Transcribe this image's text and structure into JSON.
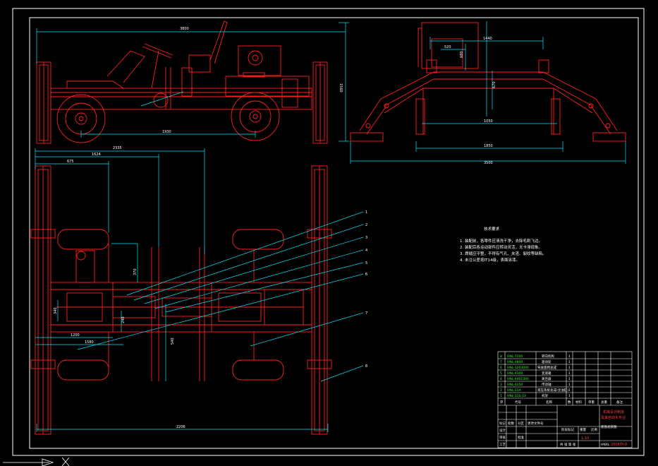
{
  "colors": {
    "background": "#000000",
    "frame": "#ffffff",
    "outline": "#ff2020",
    "dimension": "#00e5ff",
    "title_text": "#ffffff",
    "code_text": "#33ff33"
  },
  "dimensions": {
    "side_total_length": "3800",
    "side_height": "1560",
    "side_wheelbase": "1930",
    "front_top_width": "1440",
    "front_cabin_width": "520",
    "front_cabin_height": "680",
    "front_inner_height": "670",
    "front_track_inner": "1050",
    "front_track_outer": "1850",
    "front_overall_width": "3500",
    "plan_d1": "2335",
    "plan_d2": "1624",
    "plan_d3": "675",
    "plan_d4": "1200",
    "plan_d5": "1580",
    "plan_d6": "2206",
    "plan_v1": "370",
    "plan_v2": "540",
    "plan_v3": "240",
    "plan_v4": "340"
  },
  "leaders": [
    "1",
    "2",
    "3",
    "4",
    "5",
    "6",
    "7",
    "8"
  ],
  "notes": {
    "title": "技术要求",
    "items": [
      "1. 装配前，各零件应清洗干净，去除毛刺飞边。",
      "2. 装配后各运动部件应转动灵活，无卡滞现象。",
      "3. 焊缝应平整，不得有气孔、夹渣、裂纹等缺陷。",
      "4. 未注公差按IT14级，表面涂漆。"
    ]
  },
  "parts_list": [
    {
      "no": "8",
      "code": "HNL-7100",
      "name": "转向机构",
      "qty": "1"
    },
    {
      "no": "7",
      "code": "HNL-4800",
      "name": "驱动轮",
      "qty": "1"
    },
    {
      "no": "6",
      "code": "HNL-1203000",
      "name": "驾驶座椅总成",
      "qty": "1"
    },
    {
      "no": "5",
      "code": "HNL-4300",
      "name": "变速箱",
      "qty": "1"
    },
    {
      "no": "4",
      "code": "HNL-4401300",
      "name": "离合器",
      "qty": "1"
    },
    {
      "no": "3",
      "code": "HNL-4250",
      "name": "传动轴",
      "qty": "1"
    },
    {
      "no": "2",
      "code": "HNL-21A",
      "name": "液压系统总成(含油缸)",
      "qty": "1"
    },
    {
      "no": "1",
      "code": "HNL-310-23",
      "name": "机架",
      "qty": "1"
    }
  ],
  "parts_header": [
    "序",
    "代号",
    "名称",
    "数",
    "材料",
    "单重",
    "总重",
    "备注"
  ],
  "title_block": {
    "company_line1": "机械设计制造",
    "company_line2": "及其自动化专业",
    "drawing_name": "底盘总装图",
    "drawing_code": "HNXL",
    "drawing_code_suffix": "2008TY-0",
    "scale": "1:10",
    "sheet_label": "共 张 第 张",
    "row_labels": [
      "标记",
      "处数",
      "分区",
      "更改文件号",
      "签名",
      "年月日"
    ],
    "role_labels": [
      "设计",
      "审核",
      "工艺",
      "批准"
    ],
    "stage_labels": [
      "阶段标记",
      "重量",
      "比例"
    ]
  }
}
